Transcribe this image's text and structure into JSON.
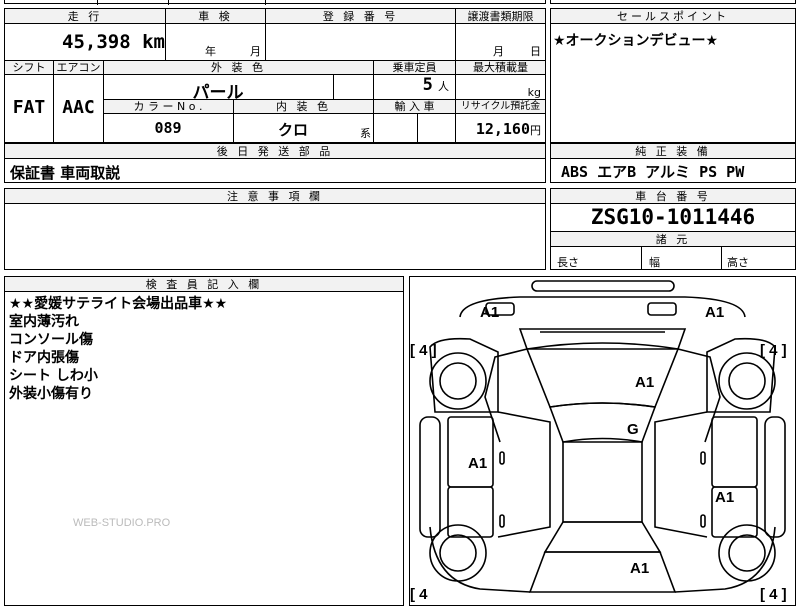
{
  "top_cut": {
    "t1": "",
    "t2": "",
    "t3": ""
  },
  "mileage": {
    "label": "走 行",
    "value": "45,398",
    "unit": "km"
  },
  "shaken": {
    "label": "車 検",
    "year": "年",
    "month": "月"
  },
  "registration": {
    "label": "登 録 番 号"
  },
  "transfer_deadline": {
    "label": "譲渡書類期限",
    "month": "月",
    "day": "日"
  },
  "selling_point": {
    "label": "セールスポイント",
    "text": "★オークションデビュー★"
  },
  "shift": {
    "label": "シフト",
    "value": "FAT"
  },
  "aircon": {
    "label": "エアコン",
    "value": "AAC"
  },
  "exterior_color": {
    "label": "外 装 色",
    "value": "パール"
  },
  "capacity": {
    "label": "乗車定員",
    "value": "5",
    "unit": "人"
  },
  "max_load": {
    "label": "最大積載量",
    "unit": "kg"
  },
  "color_no": {
    "label": "カ ラ ー N o .",
    "value": "089"
  },
  "interior_color": {
    "label": "内 装 色",
    "value": "クロ",
    "suffix": "系"
  },
  "import": {
    "label": "輸 入 車"
  },
  "recycle": {
    "label": "リサイクル預託金",
    "value": "12,160",
    "unit": "円"
  },
  "later_parts": {
    "label": "後 日 発 送 部 品",
    "value": "保証書 車両取説"
  },
  "equipment": {
    "label": "純 正 装 備",
    "value": "ABS エアB アルミ PS PW"
  },
  "notes": {
    "label": "注 意 事 項 欄"
  },
  "chassis": {
    "label": "車 台 番 号",
    "value": "ZSG10-1011446"
  },
  "dimensions": {
    "label": "諸 元",
    "length": "長さ",
    "width": "幅",
    "height": "高さ"
  },
  "inspector": {
    "label": "検 査 員 記 入 欄",
    "lines": [
      "★★愛媛サテライト会場出品車★★",
      "室内薄汚れ",
      "コンソール傷",
      "ドア内張傷",
      "シート しわ小",
      "外装小傷有り"
    ]
  },
  "watermark": "WEB-STUDIO.PRO",
  "diagram_marks": {
    "front_left": "A1",
    "front_right": "A1",
    "hood": "A1",
    "roof": "G",
    "left_door": "A1",
    "right_rear_door": "A1",
    "trunk": "A1",
    "tire_fl": "[ 4 ]",
    "tire_fr": "[ 4 ]",
    "tire_rl": "[ 4",
    "tire_rr": "[ 4 ]"
  }
}
